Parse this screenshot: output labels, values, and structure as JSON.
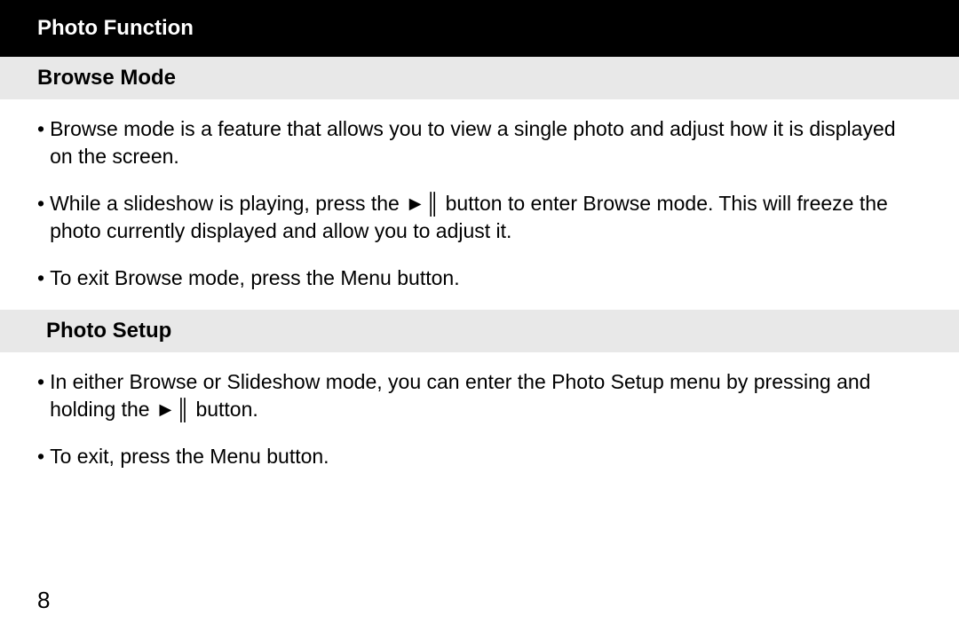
{
  "header": {
    "title": "Photo Function"
  },
  "sections": {
    "browse": {
      "title": "Browse Mode",
      "bullets": [
        "Browse mode is a feature that allows you to view a single photo and adjust how it is displayed on the screen.",
        "While a slideshow is playing, press the ►║ button to enter Browse mode.  This will freeze the photo currently displayed and allow you to adjust it.",
        "To exit Browse mode, press the Menu button."
      ]
    },
    "setup": {
      "title": "Photo Setup",
      "bullets": [
        "In either Browse or Slideshow mode, you can enter the Photo Setup menu by pressing and holding the ►║ button.",
        "To exit, press the Menu button."
      ]
    }
  },
  "page_number": "8",
  "bullet_char": "•"
}
